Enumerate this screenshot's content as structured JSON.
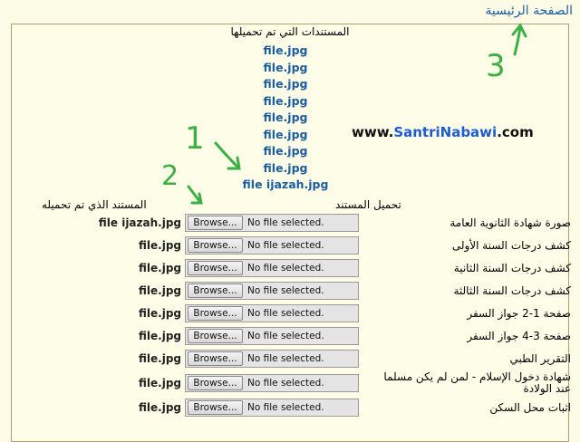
{
  "header": {
    "home_link": "الصفحة الرئيسية"
  },
  "uploaded": {
    "title": "المستندات التي تم تحميلها",
    "files": [
      "file.jpg",
      "file.jpg",
      "file.jpg",
      "file.jpg",
      "file.jpg",
      "file.jpg",
      "file.jpg",
      "file.jpg",
      "file ijazah.jpg"
    ]
  },
  "watermark": {
    "prefix": "www.",
    "brand_a": "Santri",
    "brand_b": "Nabawi",
    "suffix": ".com"
  },
  "columns": {
    "upload": "تحميل المستند",
    "stored": "المستند الذي تم تحميله"
  },
  "input": {
    "browse_label": "Browse...",
    "no_file": "No file selected."
  },
  "rows": [
    {
      "label": "صورة شهادة الثانوية العامة",
      "stored": "file ijazah.jpg"
    },
    {
      "label": "كشف درجات السنة الأولى",
      "stored": "file.jpg"
    },
    {
      "label": "كشف درجات السنة الثانية",
      "stored": "file.jpg"
    },
    {
      "label": "كشف درجات السنة الثالثة",
      "stored": "file.jpg"
    },
    {
      "label": "صفحة 1-2 جواز السفر",
      "stored": "file.jpg"
    },
    {
      "label": "صفحة 3-4 جواز السفر",
      "stored": "file.jpg"
    },
    {
      "label": "التقرير الطبي",
      "stored": "file.jpg"
    },
    {
      "label": "شهادة دخول الإسلام - لمن لم يكن مسلما عند الولادة",
      "stored": "file.jpg"
    },
    {
      "label": "اثبات محل السكن",
      "stored": "file.jpg"
    }
  ],
  "annotations": {
    "one": "1",
    "two": "2",
    "three": "3",
    "color": "#3cb043"
  }
}
